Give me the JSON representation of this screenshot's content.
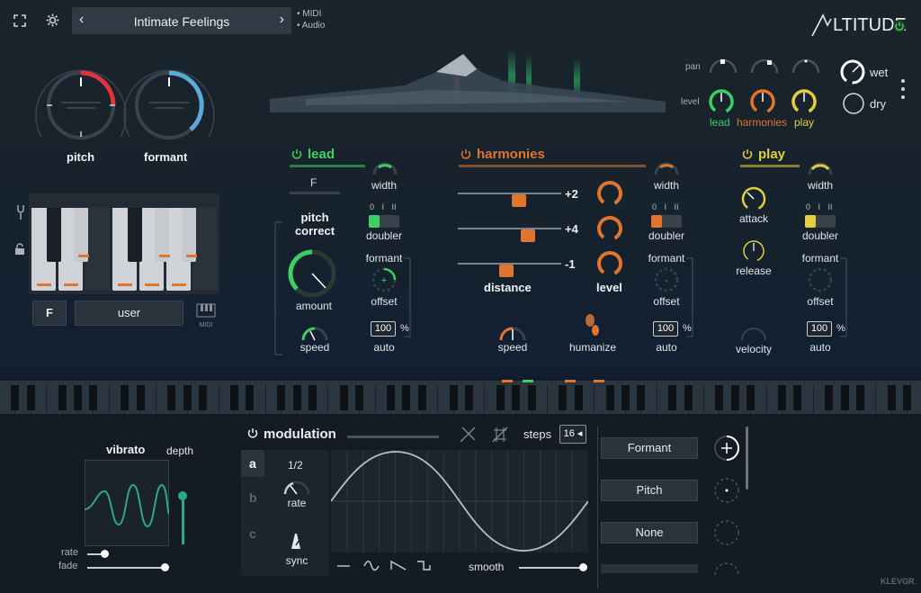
{
  "header": {
    "preset_name": "Intimate Feelings",
    "midi_label": "MIDI",
    "audio_label": "Audio",
    "logo_text": "LTITUDE"
  },
  "mix": {
    "pan_label": "pan",
    "level_label": "level",
    "lead_label": "lead",
    "harmonies_label": "harmonies",
    "play_label": "play",
    "wet_label": "wet",
    "dry_label": "dry"
  },
  "global": {
    "pitch_label": "pitch",
    "formant_label": "formant",
    "key_value": "F",
    "scale_value": "user",
    "midi_icon_label": "MIDI"
  },
  "lead": {
    "title": "lead",
    "key_display": "F",
    "pitch_correct_label": "pitch correct",
    "amount_label": "amount",
    "speed_label": "speed",
    "width_label": "width",
    "doubler_label": "doubler",
    "doubler_scale": "0 I II",
    "formant_label": "formant",
    "offset_label": "offset",
    "auto_value": "100",
    "auto_unit": "%",
    "auto_label": "auto"
  },
  "harmonies": {
    "title": "harmonies",
    "voices": [
      {
        "interval": "+2"
      },
      {
        "interval": "+4"
      },
      {
        "interval": "-1"
      }
    ],
    "distance_label": "distance",
    "level_label": "level",
    "speed_label": "speed",
    "humanize_label": "humanize",
    "width_label": "width",
    "doubler_label": "doubler",
    "doubler_scale": "0 I II",
    "formant_label": "formant",
    "offset_label": "offset",
    "auto_value": "100",
    "auto_unit": "%",
    "auto_label": "auto"
  },
  "play": {
    "title": "play",
    "attack_label": "attack",
    "release_label": "release",
    "velocity_label": "velocity",
    "width_label": "width",
    "doubler_label": "doubler",
    "doubler_scale": "0 I II",
    "formant_label": "formant",
    "offset_label": "offset",
    "auto_value": "100",
    "auto_unit": "%",
    "auto_label": "auto"
  },
  "vibrato": {
    "title": "vibrato",
    "depth_label": "depth",
    "rate_label": "rate",
    "fade_label": "fade"
  },
  "modulation": {
    "title": "modulation",
    "steps_label": "steps",
    "steps_value": "16",
    "tabs": [
      "a",
      "b",
      "c"
    ],
    "rate_value": "1/2",
    "rate_label": "rate",
    "sync_label": "sync",
    "smooth_label": "smooth",
    "targets": [
      "Formant",
      "Pitch",
      "None"
    ]
  },
  "brand": "KLEVGR.",
  "colors": {
    "lead": "#3ecf63",
    "harmonies": "#e0752f",
    "play": "#e3cf3d",
    "pitch_knob": "#e3343e",
    "formant_knob": "#5aa9d8"
  }
}
